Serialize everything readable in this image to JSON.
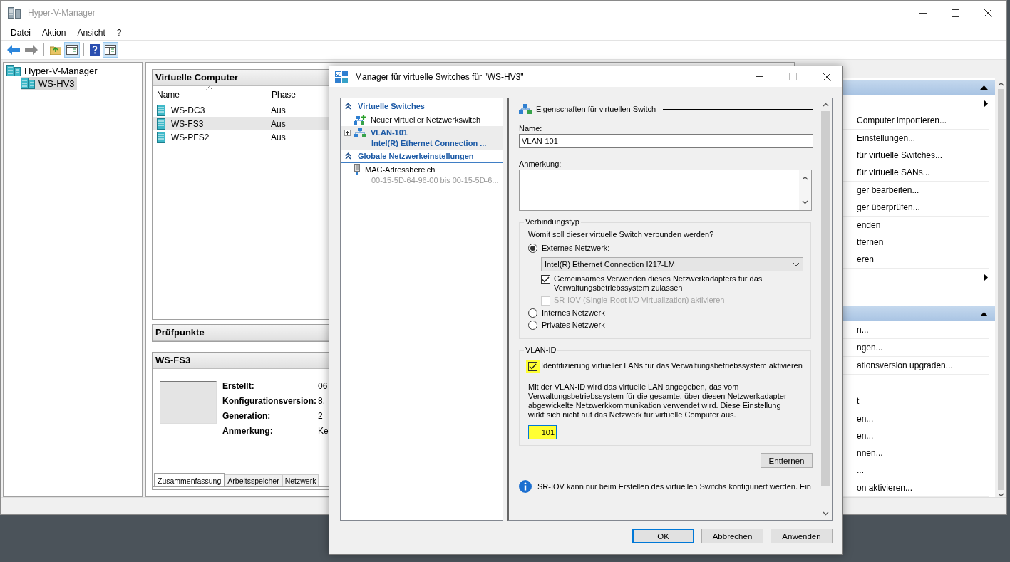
{
  "window": {
    "title": "Hyper-V-Manager"
  },
  "menu": [
    "Datei",
    "Aktion",
    "Ansicht",
    "?"
  ],
  "tree": [
    {
      "label": "Hyper-V-Manager",
      "children": [
        {
          "label": "WS-HV3",
          "selected": true
        }
      ]
    }
  ],
  "vm_panel": {
    "title": "Virtuelle Computer",
    "columns": [
      "Name",
      "Phase"
    ],
    "rows": [
      {
        "name": "WS-DC3",
        "phase": "Aus",
        "selected": false
      },
      {
        "name": "WS-FS3",
        "phase": "Aus",
        "selected": true
      },
      {
        "name": "WS-PFS2",
        "phase": "Aus",
        "selected": false
      }
    ]
  },
  "checkpoints_panel": {
    "title": "Prüfpunkte"
  },
  "details_panel": {
    "title": "WS-FS3",
    "fields": [
      {
        "label": "Erstellt:",
        "value": "06"
      },
      {
        "label": "Konfigurationsversion:",
        "value": "8."
      },
      {
        "label": "Generation:",
        "value": "2"
      },
      {
        "label": "Anmerkung:",
        "value": "Ke"
      }
    ],
    "tabs": [
      {
        "label": "Zusammenfassung",
        "selected": true
      },
      {
        "label": "Arbeitsspeicher",
        "selected": false
      },
      {
        "label": "Netzwerk",
        "selected": false
      }
    ]
  },
  "actions": {
    "sections": [
      {
        "groups": [
          [
            {
              "kind": "submenu"
            },
            {
              "kind": "item",
              "label": "Computer importieren..."
            }
          ],
          [
            {
              "kind": "item",
              "label": "Einstellungen..."
            },
            {
              "kind": "item",
              "label": "für virtuelle Switches..."
            },
            {
              "kind": "item",
              "label": "für virtuelle SANs..."
            }
          ],
          [
            {
              "kind": "item",
              "label": "ger bearbeiten..."
            },
            {
              "kind": "item",
              "label": "ger überprüfen..."
            }
          ],
          [
            {
              "kind": "item",
              "label": "enden"
            },
            {
              "kind": "item",
              "label": "tfernen"
            },
            {
              "kind": "item",
              "label": "eren"
            }
          ],
          [
            {
              "kind": "submenu"
            }
          ]
        ]
      },
      {
        "groups": [
          [
            {
              "kind": "item",
              "label": "n..."
            }
          ],
          [
            {
              "kind": "item",
              "label": "ngen..."
            }
          ],
          [
            {
              "kind": "item",
              "label": "ationsversion upgraden..."
            }
          ],
          [
            {
              "kind": "blank"
            }
          ],
          [
            {
              "kind": "item",
              "label": "t"
            }
          ],
          [
            {
              "kind": "item",
              "label": "en..."
            },
            {
              "kind": "item",
              "label": "en..."
            },
            {
              "kind": "item",
              "label": "nnen..."
            },
            {
              "kind": "item",
              "label": "..."
            }
          ],
          [
            {
              "kind": "item",
              "label": "on aktivieren..."
            }
          ]
        ]
      }
    ]
  },
  "dialog": {
    "title": "Manager für virtuelle Switches für \"WS-HV3\"",
    "nav": [
      {
        "title": "Virtuelle Switches",
        "items": [
          {
            "kind": "new",
            "label": "Neuer virtueller Netzwerkswitch",
            "selected": false
          },
          {
            "kind": "switch",
            "label": "VLAN-101",
            "sublabel": "Intel(R) Ethernet Connection ...",
            "selected": true,
            "expanded": false
          }
        ]
      },
      {
        "title": "Globale Netzwerkeinstellungen",
        "items": [
          {
            "kind": "mac",
            "label": "MAC-Adressbereich",
            "sublabel": "00-15-5D-64-96-00 bis 00-15-5D-6...",
            "selected": false
          }
        ]
      }
    ],
    "properties": {
      "heading": "Eigenschaften für virtuellen Switch",
      "name_label": "Name:",
      "name_value": "VLAN-101",
      "note_label": "Anmerkung:",
      "connection": {
        "title": "Verbindungstyp",
        "question": "Womit soll dieser virtuelle Switch verbunden werden?",
        "external": {
          "label": "Externes Netzwerk:",
          "selected": true
        },
        "adapter": "Intel(R) Ethernet Connection I217-LM",
        "share": {
          "label": "Gemeinsames Verwenden dieses Netzwerkadapters für das Verwaltungsbetriebssystem zulassen",
          "checked": true,
          "disabled": false
        },
        "sriov": {
          "label": "SR-IOV (Single-Root I/O Virtualization) aktivieren",
          "checked": false,
          "disabled": true
        },
        "others": [
          {
            "label": "Internes Netzwerk",
            "selected": false
          },
          {
            "label": "Privates Netzwerk",
            "selected": false
          }
        ]
      },
      "vlan": {
        "title": "VLAN-ID",
        "enable": {
          "label": "Identifizierung virtueller LANs für das Verwaltungsbetriebssystem aktivieren",
          "checked": true,
          "highlighted": true
        },
        "description": "Mit der VLAN-ID wird das virtuelle LAN angegeben, das vom Verwaltungsbetriebssystem für die gesamte, über diesen Netzwerkadapter abgewickelte Netzwerkkommunikation verwendet wird. Diese Einstellung wirkt sich nicht auf das Netzwerk für virtuelle Computer aus.",
        "value": "101",
        "highlighted": true
      },
      "remove_button": "Entfernen",
      "info": "SR-IOV kann nur beim Erstellen des virtuellen Switchs konfiguriert werden. Ein"
    },
    "buttons": [
      {
        "label": "OK",
        "default": true
      },
      {
        "label": "Abbrechen",
        "default": false
      },
      {
        "label": "Anwenden",
        "default": false
      }
    ]
  }
}
